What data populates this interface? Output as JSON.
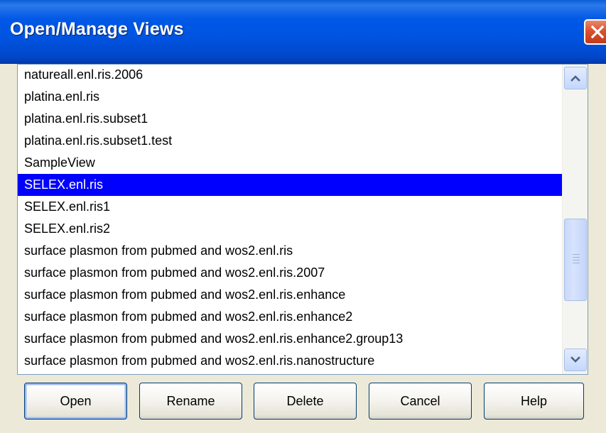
{
  "window": {
    "title": "Open/Manage Views",
    "title_color": "#ffffff",
    "titlebar_color": "#0054e3",
    "close_icon": "close-x-icon"
  },
  "views_list": {
    "items": [
      "natureall.enl.ris.2006",
      "platina.enl.ris",
      "platina.enl.ris.subset1",
      "platina.enl.ris.subset1.test",
      "SampleView",
      "SELEX.enl.ris",
      "SELEX.enl.ris1",
      "SELEX.enl.ris2",
      "surface plasmon from pubmed and wos2.enl.ris",
      "surface plasmon from pubmed and wos2.enl.ris.2007",
      "surface plasmon from pubmed and wos2.enl.ris.enhance",
      "surface plasmon from pubmed and wos2.enl.ris.enhance2",
      "surface plasmon from pubmed and wos2.enl.ris.enhance2.group13",
      "surface plasmon from pubmed and wos2.enl.ris.nanostructure"
    ],
    "selected": "SELEX.enl.ris",
    "selection_color": "#0000ff"
  },
  "scrollbar": {
    "up_icon": "chevron-up-icon",
    "down_icon": "chevron-down-icon",
    "thumb_icon": "grip-icon"
  },
  "buttons": {
    "open": "Open",
    "rename": "Rename",
    "delete": "Delete",
    "cancel": "Cancel",
    "help": "Help"
  }
}
